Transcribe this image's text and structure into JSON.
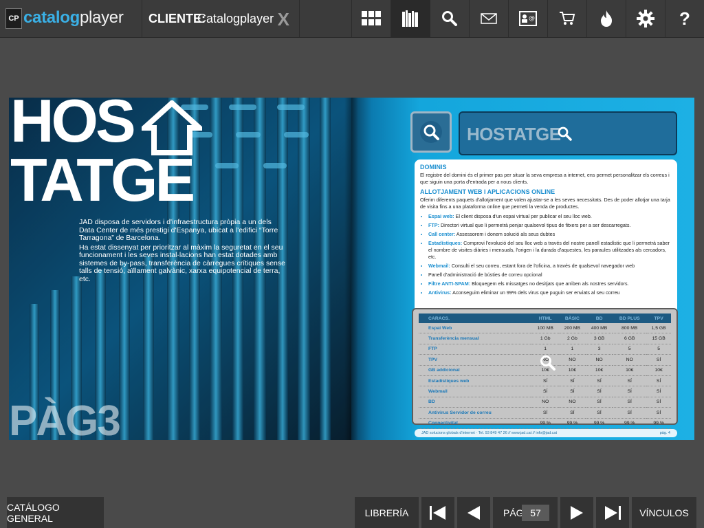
{
  "app": {
    "logo_badge": "CP",
    "logo_part1": "catalog",
    "logo_part2": "player"
  },
  "client": {
    "label": "CLIENTE:",
    "name": "Catalogplayer",
    "close": "X"
  },
  "toolbar": [
    {
      "name": "grid-view-button",
      "icon": "grid-icon",
      "active": false
    },
    {
      "name": "library-button",
      "icon": "books-icon",
      "active": true
    },
    {
      "name": "search-button",
      "icon": "search-icon",
      "active": false
    },
    {
      "name": "email-button",
      "icon": "envelope-icon",
      "active": false
    },
    {
      "name": "contact-button",
      "icon": "contact-card-icon",
      "active": false
    },
    {
      "name": "cart-button",
      "icon": "cart-icon",
      "active": false
    },
    {
      "name": "hot-button",
      "icon": "flame-icon",
      "active": false
    },
    {
      "name": "settings-button",
      "icon": "gear-icon",
      "active": false
    },
    {
      "name": "help-button",
      "icon": "question-icon",
      "active": false
    }
  ],
  "left_page": {
    "title_line1": "HOS",
    "title_line2": "TATGE",
    "intro_p1": "JAD disposa de servidors i d'infraestructura pròpia a un dels Data Center de més prestigi d'Espanya, ubicat a l'edifici “Torre Tarragona” de Barcelona.",
    "intro_p2": "Ha estat dissenyat per prioritzar al màxim la seguretat en el seu funcionament i les seves instal·lacions han estat dotades amb sistemes de by-pass, transferència de càrregues crítiques sense talls de tensió, aïllament galvànic, xarxa equipotencial de terra, etc.",
    "page_label": "PÀG3"
  },
  "right_page": {
    "header_title": "HOSTATGE",
    "section1_title": "DOMINIS",
    "section1_text": "El registre del domini és el primer pas per situar la seva empresa a internet, ens permet personalitzar els correus i que siguin una porta d'entrada per a nous clients.",
    "section2_title": "ALLOTJAMENT WEB I APLICACIONS ONLINE",
    "section2_text": "Oferim diferents paquets d'allotjament que volen ajustar-se a les seves necessitats. Des de poder allotjar una tarja de visita fins a una plataforma online que permeti la venda de productes.",
    "bullets": [
      {
        "title": "Espai web:",
        "text": "El client disposa d'un espai virtual per publicar el seu lloc web."
      },
      {
        "title": "FTP:",
        "text": "Directori virtual que li permetrà penjar qualsevol tipus de fitxers per a ser descarregats."
      },
      {
        "title": "Call center:",
        "text": "Assessorem i donem solució als seus dubtes"
      },
      {
        "title": "Estadístiques:",
        "text": "Comprovi l'evolució del seu lloc web a través del nostre panell estadístic que li permetrà saber el nombre de visites diàries i mensuals, l'origen i la durada d'aquestes, les paraules utilitzades als cercadors, etc."
      },
      {
        "title": "Webmail:",
        "text": "Consulti el seu correu, estant fora de l'oficina, a través de qualsevol navegador web"
      },
      {
        "title": "",
        "text": "Panell d'administració de bústies de correu opcional"
      },
      {
        "title": "Filtre ANTI-SPAM:",
        "text": "Bloquegem els missatges no desitjats que arriben als nostres servidors."
      },
      {
        "title": "Antivirus:",
        "text": "Aconseguim eliminar un 99% dels virus que puguin ser enviats al seu correu"
      }
    ],
    "table": {
      "headers": [
        "CARACS.",
        "HTML",
        "BÀSIC",
        "BD",
        "BD PLUS",
        "TPV"
      ],
      "rows": [
        [
          "Espai Web",
          "100 MB",
          "200 MB",
          "400 MB",
          "800 MB",
          "1,5 GB"
        ],
        [
          "Transferència mensual",
          "1 Gb",
          "2 Gb",
          "3 GB",
          "6 GB",
          "15 GB"
        ],
        [
          "FTP",
          "1",
          "1",
          "3",
          "5",
          "5"
        ],
        [
          "TPV",
          "NO",
          "NO",
          "NO",
          "NO",
          "SÍ"
        ],
        [
          "GB addicional",
          "10€",
          "10€",
          "10€",
          "10€",
          "10€"
        ],
        [
          "Estadístiques web",
          "SÍ",
          "SÍ",
          "SÍ",
          "SÍ",
          "SÍ"
        ],
        [
          "Webmail",
          "SÍ",
          "SÍ",
          "SÍ",
          "SÍ",
          "SÍ"
        ],
        [
          "BD",
          "NO",
          "NO",
          "SÍ",
          "SÍ",
          "SÍ"
        ],
        [
          "Antivirus Servidor de correu",
          "SÍ",
          "SÍ",
          "SÍ",
          "SÍ",
          "SÍ"
        ],
        [
          "Connectivitat",
          "99 %",
          "99 %",
          "99 %",
          "99 %",
          "99 %"
        ]
      ]
    },
    "footer_text": "JAD solucions globals d'internet · Tel. 93 849 47 26 // www.jad.cat // info@jad.cat",
    "footer_page": "pàg. 4"
  },
  "bottom": {
    "catalog_general": "CATÁLOGO GENERAL",
    "library": "LIBRERÍA",
    "page_label": "PÁG",
    "page_value": "57",
    "links": "VÍNCULOS"
  }
}
